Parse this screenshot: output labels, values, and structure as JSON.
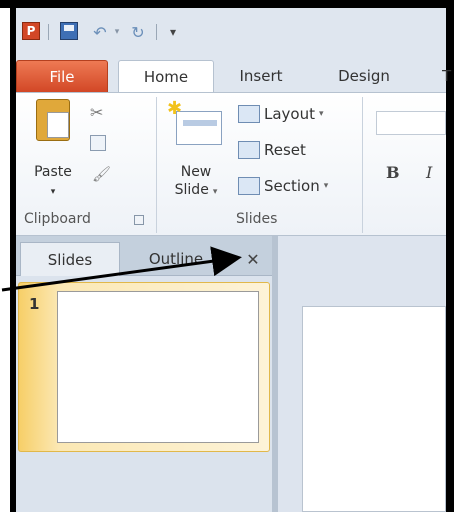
{
  "quick_access": {
    "app_icon_letter": "P",
    "items": [
      "save-icon",
      "undo-icon",
      "redo-icon",
      "customize-icon"
    ]
  },
  "tabs": {
    "file": "File",
    "home": "Home",
    "insert": "Insert",
    "design": "Design",
    "next_partial": "T"
  },
  "ribbon": {
    "clipboard": {
      "paste_label": "Paste",
      "group_label": "Clipboard"
    },
    "slides": {
      "new_slide_line1": "New",
      "new_slide_line2": "Slide",
      "layout_label": "Layout",
      "reset_label": "Reset",
      "section_label": "Section",
      "group_label": "Slides"
    },
    "font": {
      "bold_label": "B",
      "italic_label": "I"
    }
  },
  "panel": {
    "tab_slides": "Slides",
    "tab_outline": "Outline",
    "close_glyph": "✕",
    "thumbnails": [
      {
        "number": "1"
      }
    ]
  },
  "colors": {
    "file_tab": "#d24726",
    "selected_thumbnail": "#f7cf68",
    "ribbon_bg": "#dfe6ef"
  }
}
